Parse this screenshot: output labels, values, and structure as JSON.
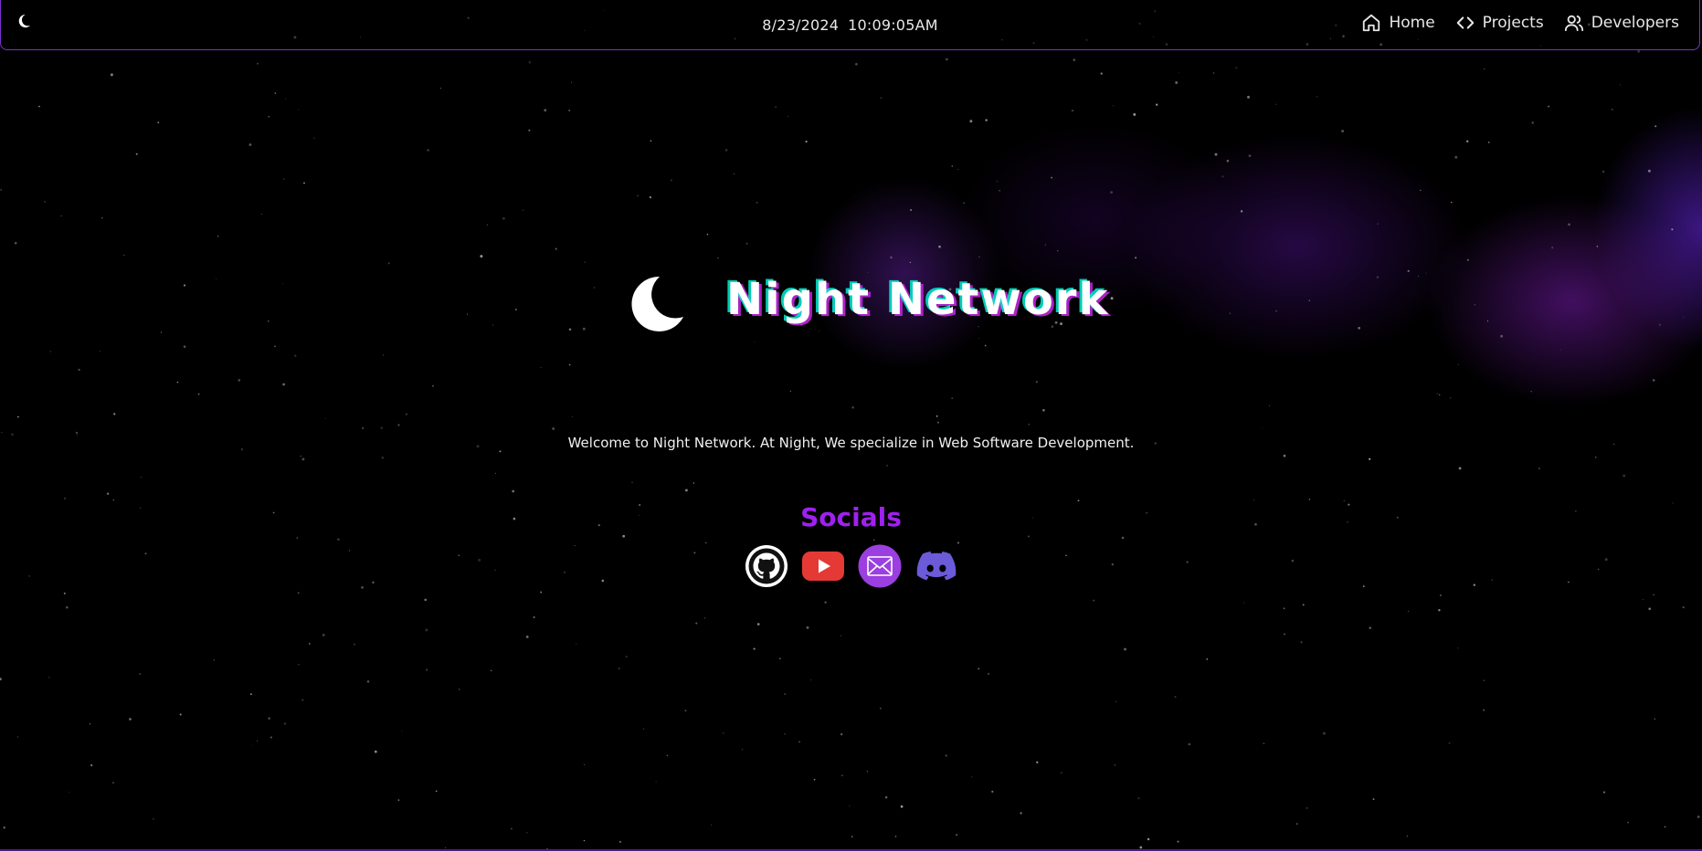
{
  "navbar": {
    "logo_icon": "moon-icon",
    "date": "8/23/2024",
    "time": "10:09:05AM",
    "links": [
      {
        "label": "Home",
        "icon": "home-icon"
      },
      {
        "label": "Projects",
        "icon": "code-icon"
      },
      {
        "label": "Developers",
        "icon": "users-icon"
      }
    ],
    "border_color": "#7a2fd0"
  },
  "hero": {
    "icon": "moon-icon",
    "title": "Night Network",
    "tagline": "Welcome to Night Network. At Night, We specialize in Web Software Development."
  },
  "socials": {
    "heading": "Socials",
    "heading_color": "#a020f0",
    "items": [
      {
        "name": "GitHub",
        "icon": "github-icon"
      },
      {
        "name": "YouTube",
        "icon": "youtube-icon",
        "color": "#e53935"
      },
      {
        "name": "Email",
        "icon": "mail-icon",
        "color": "#9b3fe0"
      },
      {
        "name": "Discord",
        "icon": "discord-icon",
        "color": "#6b5bd9"
      }
    ]
  },
  "theme": {
    "background": "#000000",
    "accent": "#7a2fd0"
  }
}
